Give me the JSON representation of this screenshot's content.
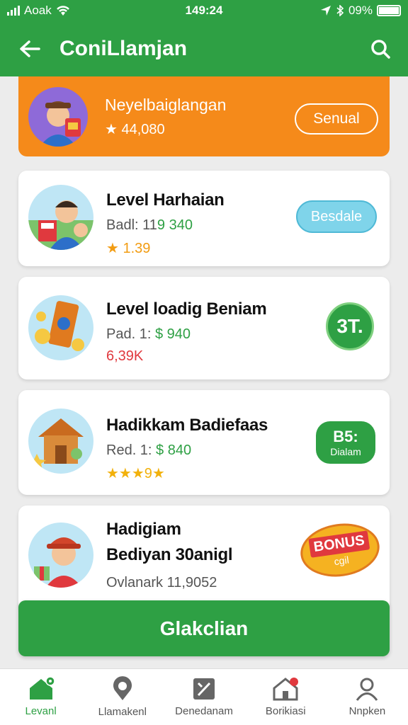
{
  "status": {
    "carrier": "Aoak",
    "time": "149:24",
    "battery": "09%"
  },
  "appbar": {
    "title": "ConiLlamjan",
    "back_icon": "arrow-left-icon",
    "search_icon": "search-icon"
  },
  "banner": {
    "title": "Neyelbaiglangan",
    "rating": "★ 44,080",
    "button": "Senual"
  },
  "cards": [
    {
      "title": "Level Harhaian",
      "line1_prefix": "Badl: 11",
      "line1_value": "9 340",
      "line2": "★ 1.39",
      "badge": "Besdale"
    },
    {
      "title": "Level loadig Beniam",
      "line1_prefix": "Pad. 1: ",
      "line1_value": "$ 940",
      "line2": "6,39K",
      "badge": "3T."
    },
    {
      "title": "Hadikkam Badiefaas",
      "line1_prefix": "Red. 1: ",
      "line1_value": "$ 840",
      "line2": "★★★9★",
      "badge_top": "B5:",
      "badge_bottom": "Dialam"
    },
    {
      "title_line1": "Hadigiam",
      "title_line2": "Bediyan 30anigl",
      "line1": "Ovlanark 11,9052",
      "badge_top": "BONUS",
      "badge_bottom": "cgil"
    }
  ],
  "cta": {
    "label": "Glakclian"
  },
  "nav": [
    {
      "label": "Levanl",
      "icon": "home-icon"
    },
    {
      "label": "Llamakenl",
      "icon": "location-pin-icon"
    },
    {
      "label": "Denedanam",
      "icon": "calendar-icon"
    },
    {
      "label": "Borikiasi",
      "icon": "house-notification-icon"
    },
    {
      "label": "Nnpken",
      "icon": "user-icon"
    }
  ],
  "colors": {
    "primary": "#2ea044",
    "banner": "#f58a1a",
    "badge_blue": "#7fd4ea"
  }
}
